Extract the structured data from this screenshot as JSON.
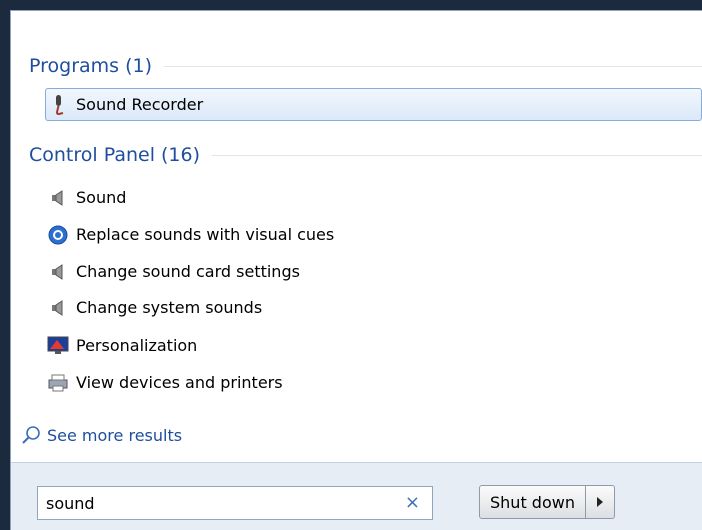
{
  "programs": {
    "header": "Programs (1)",
    "items": [
      {
        "label": "Sound Recorder",
        "icon": "microphone-icon"
      }
    ]
  },
  "control_panel": {
    "header": "Control Panel (16)",
    "items": [
      {
        "label": "Sound",
        "icon": "speaker-icon"
      },
      {
        "label": "Replace sounds with visual cues",
        "icon": "ease-of-access-icon"
      },
      {
        "label": "Change sound card settings",
        "icon": "speaker-icon"
      },
      {
        "label": "Change system sounds",
        "icon": "speaker-icon"
      },
      {
        "label": "Personalization",
        "icon": "monitor-icon"
      },
      {
        "label": "View devices and printers",
        "icon": "printer-icon"
      }
    ]
  },
  "see_more": {
    "label": "See more results",
    "icon": "search-icon"
  },
  "search": {
    "value": "sound",
    "clear_glyph": "×"
  },
  "shutdown": {
    "label": "Shut down",
    "arrow_icon": "arrow-right-icon"
  }
}
